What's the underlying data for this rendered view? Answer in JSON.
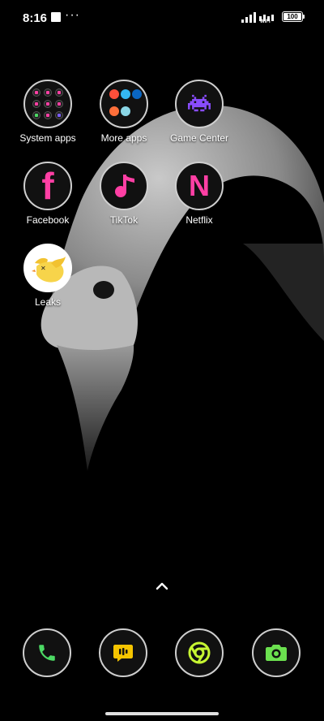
{
  "status_bar": {
    "time": "8:16",
    "overflow": "···",
    "wifi_label": "WiFi",
    "battery": "100"
  },
  "apps": [
    {
      "label": "System apps",
      "type": "folder"
    },
    {
      "label": "More apps",
      "type": "folder"
    },
    {
      "label": "Game Center",
      "icon": "space-invader-icon"
    },
    {
      "label": "Facebook",
      "icon": "facebook-f-icon",
      "glyph": "f",
      "color": "#ff3fa4"
    },
    {
      "label": "TikTok",
      "icon": "music-note-icon",
      "color": "#ff3fa4"
    },
    {
      "label": "Netflix",
      "icon": "netflix-n-icon",
      "glyph": "N",
      "color": "#ff3fa4"
    },
    {
      "label": "Leaks",
      "icon": "yellow-bird-icon"
    }
  ],
  "dock": [
    {
      "name": "phone",
      "icon": "phone-icon",
      "color": "#4cd964"
    },
    {
      "name": "messages",
      "icon": "message-icon",
      "color": "#f5c400"
    },
    {
      "name": "chrome",
      "icon": "chrome-icon",
      "color": "#c6f532"
    },
    {
      "name": "camera",
      "icon": "camera-icon",
      "color": "#6be04f"
    }
  ],
  "colors": {
    "accent_pink": "#ff3fa4",
    "icon_ring": "#cfcfcf",
    "background": "#000000"
  }
}
